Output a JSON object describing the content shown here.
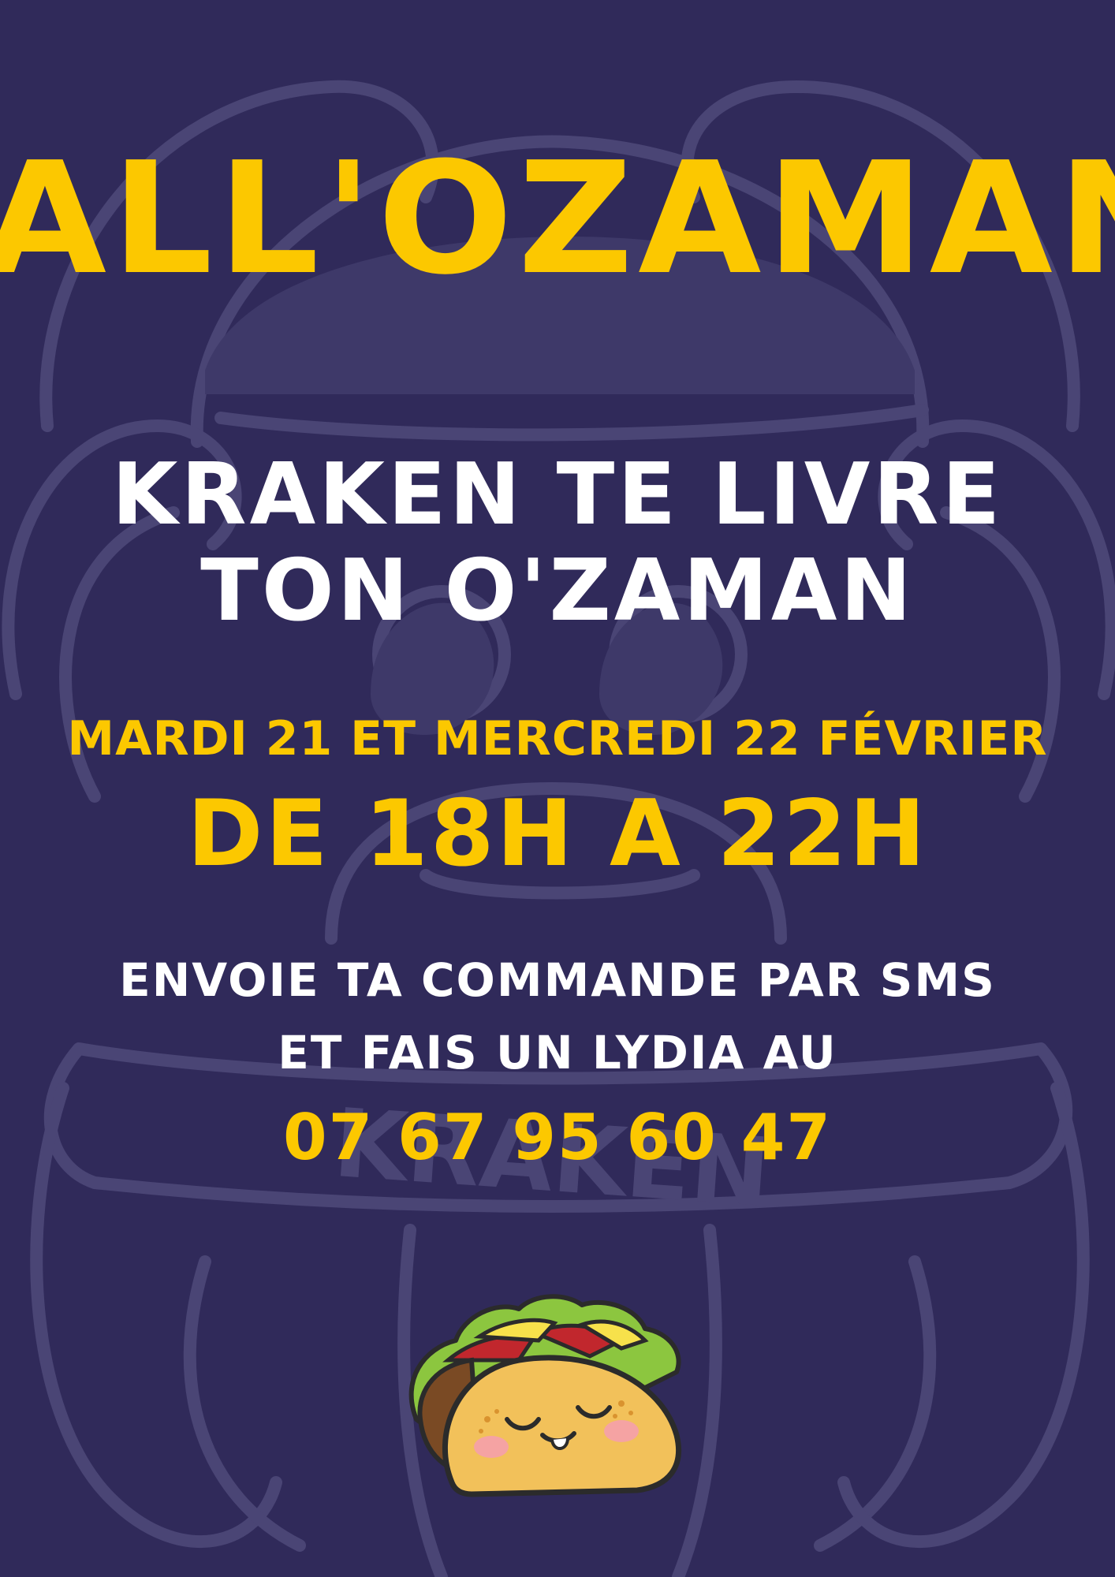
{
  "poster": {
    "title": "ALL'OZAMAN",
    "subtitle_line1": "KRAKEN TE LIVRE",
    "subtitle_line2": "TON O'ZAMAN",
    "dates": "MARDI 21 ET MERCREDI 22 FÉVRIER",
    "hours": "DE 18H A 22H",
    "instruction_line1": "ENVOIE TA COMMANDE PAR SMS",
    "instruction_line2": "ET FAIS UN LYDIA AU",
    "phone": "07 67 95 60 47",
    "watermark_text": "KRAKEN"
  },
  "colors": {
    "background": "#302a5a",
    "accent_yellow": "#fcc800",
    "text_white": "#ffffff",
    "watermark": "#4a4575"
  },
  "icons": {
    "background_graphic": "kraken-octopus-watermark",
    "illustration": "smiling-taco-icon"
  }
}
